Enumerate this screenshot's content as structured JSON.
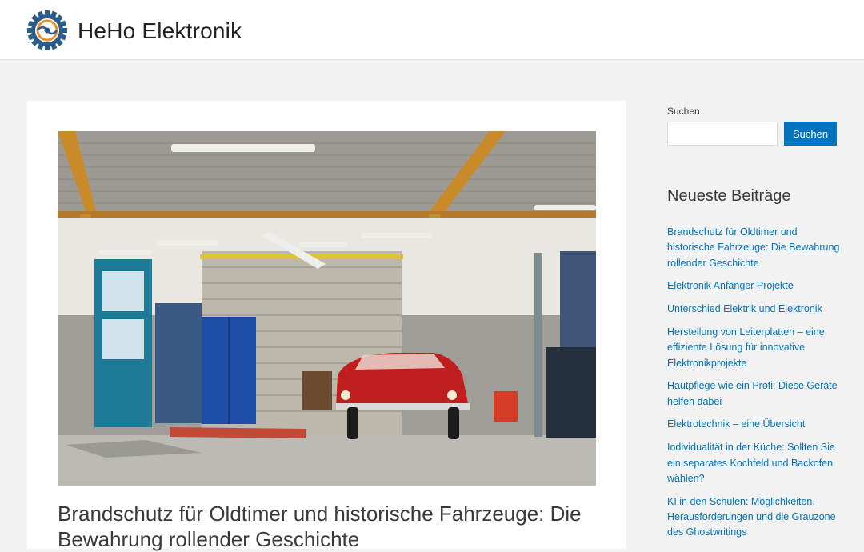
{
  "header": {
    "site_title": "HeHo Elektronik",
    "logo_icon": "gear-circuit-logo-icon",
    "brand_colors": {
      "gear": "#2a5d8c",
      "accent": "#e8912d"
    }
  },
  "main": {
    "featured_image": "garage-workshop-red-classic-car-image",
    "post_title": "Brandschutz für Oldtimer und historische Fahrzeuge: Die Bewahrung rollender Geschichte"
  },
  "sidebar": {
    "search": {
      "label": "Suchen",
      "input_value": "",
      "button_label": "Suchen"
    },
    "recent_posts": {
      "title": "Neueste Beiträge",
      "items": [
        "Brandschutz für Oldtimer und historische Fahrzeuge: Die Bewahrung rollender Geschichte",
        "Elektronik Anfänger Projekte",
        "Unterschied Elektrik und Elektronik",
        "Herstellung von Leiterplatten – eine effiziente Lösung für innovative Elektronikprojekte",
        "Hautpflege wie ein Profi: Diese Geräte helfen dabei",
        "Elektrotechnik – eine Übersicht",
        "Individualität in der Küche: Sollten Sie ein separates Kochfeld und Backofen wählen?",
        "KI in den Schulen: Möglichkeiten, Herausforderungen und die Grauzone des Ghostwritings"
      ]
    }
  },
  "colors": {
    "link": "#0274be",
    "button_bg": "#0274be",
    "page_bg": "#f2f2f2",
    "text": "#3a3a3a"
  }
}
